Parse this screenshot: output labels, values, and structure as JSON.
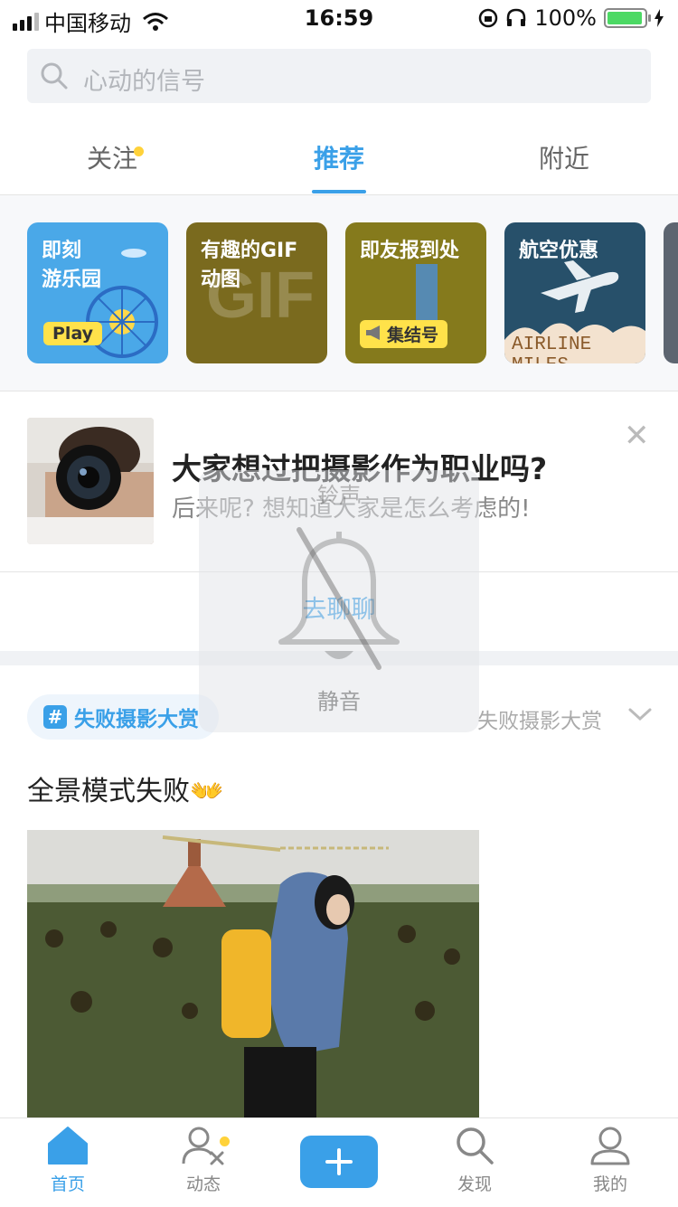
{
  "status_bar": {
    "carrier": "中国移动",
    "time": "16:59",
    "battery_percent": "100%"
  },
  "search": {
    "placeholder": "心动的信号"
  },
  "tabs": [
    {
      "label": "关注",
      "has_dot": true
    },
    {
      "label": "推荐",
      "active": true
    },
    {
      "label": "附近"
    }
  ],
  "cards": [
    {
      "title": "即刻\n游乐园",
      "tag": "Play",
      "bg": "#4aa8e8"
    },
    {
      "title": "有趣的GIF\n动图",
      "watermark": "GIF",
      "bg": "#7a6a1e"
    },
    {
      "title": "即友报到处",
      "tag": "集结号",
      "bg": "#857a1c"
    },
    {
      "title": "航空优惠",
      "footer": "AIRLINE MILES",
      "bg": "#27506a"
    }
  ],
  "post": {
    "title": "大家想过把摄影作为职业吗?",
    "subtitle": "后来呢? 想知道大家是怎么考虑的!",
    "action": "去聊聊"
  },
  "mute_overlay": {
    "title": "铃声",
    "label": "静音"
  },
  "topic": {
    "chip_label": "失败摄影大赏",
    "right_label": "失败摄影大赏"
  },
  "post2": {
    "title": "全景模式失败👐"
  },
  "bottom_nav": [
    {
      "label": "首页",
      "active": true
    },
    {
      "label": "动态",
      "has_dot": true
    },
    {
      "label": ""
    },
    {
      "label": "发现"
    },
    {
      "label": "我的"
    }
  ],
  "colors": {
    "accent": "#3aa0e8",
    "dot": "#ffd23a"
  }
}
